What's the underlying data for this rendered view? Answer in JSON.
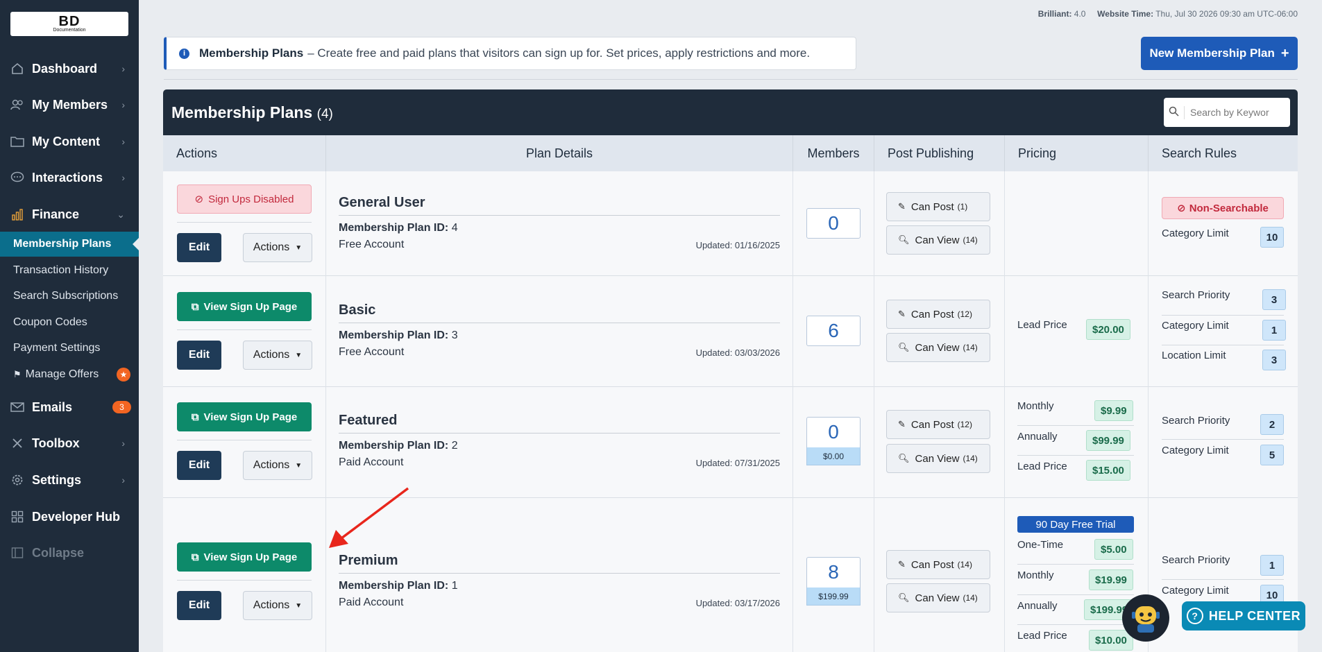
{
  "sidebar": {
    "logo_main": "BD",
    "logo_sub": "Documentation",
    "items": [
      {
        "label": "Dashboard"
      },
      {
        "label": "My Members"
      },
      {
        "label": "My Content"
      },
      {
        "label": "Interactions"
      },
      {
        "label": "Finance"
      },
      {
        "label": "Emails",
        "badge": "3"
      },
      {
        "label": "Toolbox"
      },
      {
        "label": "Settings"
      },
      {
        "label": "Developer Hub"
      },
      {
        "label": "Collapse"
      }
    ],
    "finance_sub": [
      {
        "label": "Membership Plans"
      },
      {
        "label": "Transaction History"
      },
      {
        "label": "Search Subscriptions"
      },
      {
        "label": "Coupon Codes"
      },
      {
        "label": "Payment Settings"
      },
      {
        "label": "Manage Offers"
      }
    ]
  },
  "topbar": {
    "brilliant_label": "Brilliant:",
    "brilliant_version": "4.0",
    "time_label": "Website Time:",
    "time_value": "Thu, Jul 30 2026 09:30 am UTC-06:00"
  },
  "info": {
    "title": "Membership Plans",
    "text": "– Create free and paid plans that visitors can sign up for. Set prices, apply restrictions and more."
  },
  "new_plan_label": "New Membership Plan",
  "panel": {
    "title": "Membership Plans",
    "count": "(4)",
    "search_placeholder": "Search by Keywor"
  },
  "columns": [
    "Actions",
    "Plan Details",
    "Members",
    "Post Publishing",
    "Pricing",
    "Search Rules"
  ],
  "labels": {
    "edit": "Edit",
    "actions": "Actions",
    "view_signup": "View Sign Up Page",
    "signups_disabled": "Sign Ups Disabled",
    "plan_id": "Membership Plan ID:",
    "can_post": "Can Post",
    "can_view": "Can View",
    "non_searchable": "Non-Searchable"
  },
  "plans": [
    {
      "name": "General User",
      "id": "4",
      "account": "Free Account",
      "updated": "Updated: 01/16/2025",
      "members": "0",
      "post_count": "(1)",
      "view_count": "(14)",
      "rules": [
        {
          "label": "Category Limit",
          "value": "10"
        }
      ]
    },
    {
      "name": "Basic",
      "id": "3",
      "account": "Free Account",
      "updated": "Updated: 03/03/2026",
      "members": "6",
      "post_count": "(12)",
      "view_count": "(14)",
      "pricing": [
        {
          "label": "Lead Price",
          "value": "$20.00"
        }
      ],
      "rules": [
        {
          "label": "Search Priority",
          "value": "3"
        },
        {
          "label": "Category Limit",
          "value": "1"
        },
        {
          "label": "Location Limit",
          "value": "3"
        }
      ]
    },
    {
      "name": "Featured",
      "id": "2",
      "account": "Paid Account",
      "updated": "Updated: 07/31/2025",
      "members": "0",
      "member_price": "$0.00",
      "post_count": "(12)",
      "view_count": "(14)",
      "pricing": [
        {
          "label": "Monthly",
          "value": "$9.99"
        },
        {
          "label": "Annually",
          "value": "$99.99"
        },
        {
          "label": "Lead Price",
          "value": "$15.00"
        }
      ],
      "rules": [
        {
          "label": "Search Priority",
          "value": "2"
        },
        {
          "label": "Category Limit",
          "value": "5"
        }
      ]
    },
    {
      "name": "Premium",
      "id": "1",
      "account": "Paid Account",
      "updated": "Updated: 03/17/2026",
      "members": "8",
      "member_price": "$199.99",
      "post_count": "(14)",
      "view_count": "(14)",
      "trial": "90 Day Free Trial",
      "pricing": [
        {
          "label": "One-Time",
          "value": "$5.00"
        },
        {
          "label": "Monthly",
          "value": "$19.99"
        },
        {
          "label": "Annually",
          "value": "$199.99"
        },
        {
          "label": "Lead Price",
          "value": "$10.00"
        }
      ],
      "rules": [
        {
          "label": "Search Priority",
          "value": "1"
        },
        {
          "label": "Category Limit",
          "value": "10"
        }
      ]
    }
  ],
  "help_center": "HELP CENTER",
  "colors": {
    "sidebar": "#1f2c3b",
    "accent_blue": "#1e5bb8",
    "green": "#0d8a6a",
    "active_teal": "#0b6e8c"
  }
}
